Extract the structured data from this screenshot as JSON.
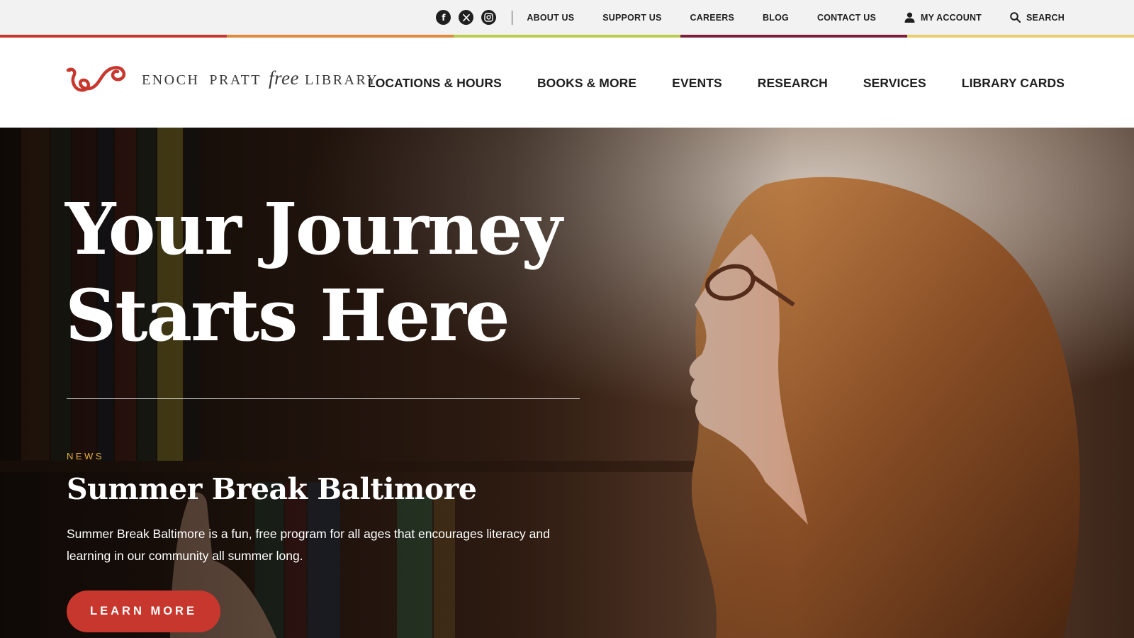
{
  "utility_bar": {
    "social": [
      {
        "icon": "facebook-icon",
        "label": "f"
      },
      {
        "icon": "x-twitter-icon",
        "label": "𝕏"
      },
      {
        "icon": "instagram-icon",
        "label": ""
      }
    ],
    "links": [
      {
        "label": "ABOUT US"
      },
      {
        "label": "SUPPORT US"
      },
      {
        "label": "CAREERS"
      },
      {
        "label": "BLOG"
      },
      {
        "label": "CONTACT US"
      }
    ],
    "account_label": "MY ACCOUNT",
    "search_label": "SEARCH"
  },
  "stripe_colors": [
    "#c8372d",
    "#e08a3a",
    "#b9cc4c",
    "#7b1f3a",
    "#e8cf6a"
  ],
  "logo": {
    "word1": "ENOCH",
    "word2": "PRATT",
    "word3": "free",
    "word4": "LIBRARY",
    "mark_color": "#c8372d"
  },
  "main_nav": [
    {
      "label": "LOCATIONS & HOURS"
    },
    {
      "label": "BOOKS & MORE"
    },
    {
      "label": "EVENTS"
    },
    {
      "label": "RESEARCH"
    },
    {
      "label": "SERVICES"
    },
    {
      "label": "LIBRARY CARDS"
    }
  ],
  "hero": {
    "title_line1": "Your Journey",
    "title_line2": "Starts Here",
    "news_label": "NEWS",
    "news_headline": "Summer Break Baltimore",
    "news_body": "Summer Break Baltimore is a fun, free program for all ages that encourages literacy and learning in our community all summer long.",
    "cta_label": "LEARN MORE",
    "accent_color": "#c8372d",
    "label_color": "#e4b23f"
  }
}
